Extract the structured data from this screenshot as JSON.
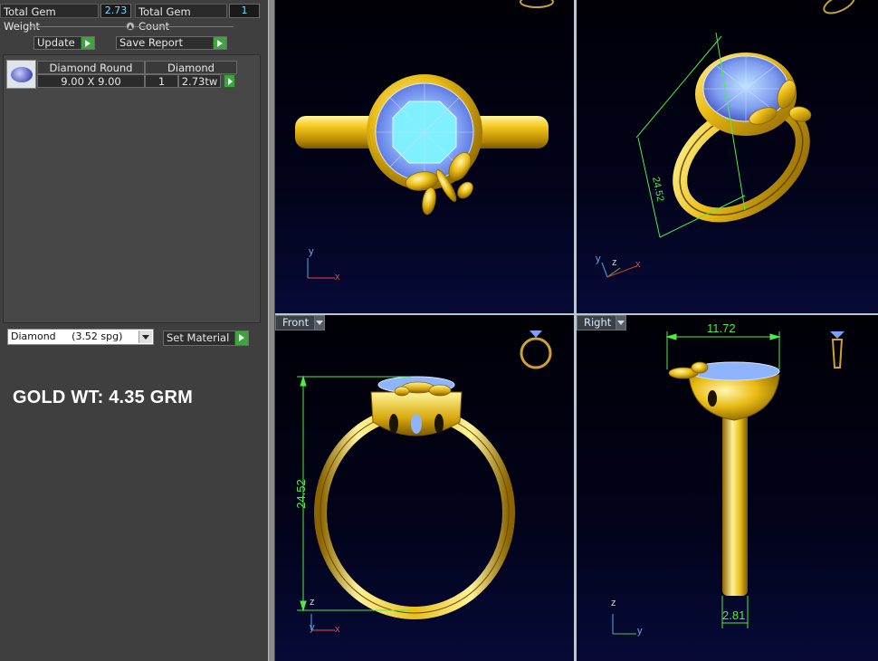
{
  "stats": {
    "total_gem_weight_label": "Total Gem Weight",
    "total_gem_weight_value": "2.73",
    "total_gem_count_label": "Total Gem Count",
    "total_gem_count_value": "1"
  },
  "actions": {
    "update_label": "Update",
    "save_report_label": "Save Report",
    "set_material_label": "Set Material"
  },
  "gem_list": {
    "items": [
      {
        "name": "Diamond Round",
        "material": "Diamond",
        "size": "9.00 X 9.00",
        "count": "1",
        "weight": "2.73tw",
        "icon": "round-gem-thumbnail-icon"
      }
    ]
  },
  "material": {
    "selected": "Diamond     (3.52 spg)"
  },
  "gold_weight": "GOLD WT: 4.35 GRM",
  "viewports": {
    "top": {
      "axis_v": "y",
      "axis_h": "x"
    },
    "perspective": {
      "dimension": "24.52",
      "axis_v": "y",
      "axis_mid": "z",
      "axis_h": "x"
    },
    "front": {
      "label": "Front",
      "dimension": "24.52",
      "axis_z": "z",
      "axis_v": "y",
      "axis_h": "x"
    },
    "right": {
      "label": "Right",
      "dimension_top": "11.72",
      "dimension_bottom": "2.81",
      "axis_v": "z",
      "axis_h": "y"
    }
  },
  "colors": {
    "gold": "#e8bf1a",
    "dimension_green": "#4bef42",
    "gem_blue": "#8fb4ff",
    "viewport_bg": "#02031a",
    "panel_bg": "#3f3f3f"
  }
}
